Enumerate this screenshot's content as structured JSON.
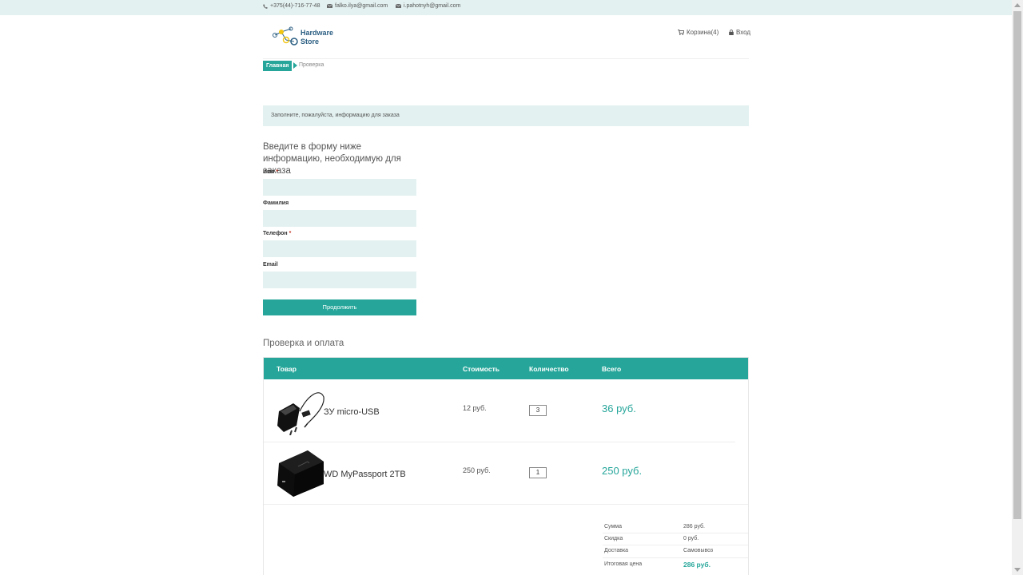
{
  "topbar": {
    "phone": "+375(44)-716-77-48",
    "email1": "falko.ilya@gmail.com",
    "email2": "i.pahotnyh@gmail.com"
  },
  "header": {
    "logo_line1": "Hardware",
    "logo_line2": "Store",
    "cart_label": "Корзина(4)",
    "login_label": "Вход"
  },
  "breadcrumb": {
    "home": "Главная",
    "current": "Проверка"
  },
  "notice": "Заполните, пожалуйста, информацию для заказа",
  "form": {
    "title": "Введите в форму ниже информацию, необходимую для заказа",
    "fields": [
      {
        "label": "Имя",
        "required": "*",
        "value": ""
      },
      {
        "label": "Фамилия",
        "required": "",
        "value": ""
      },
      {
        "label": "Телефон",
        "required": "*",
        "value": ""
      },
      {
        "label": "Email",
        "required": "",
        "value": ""
      }
    ],
    "submit": "Продолжить"
  },
  "checkout": {
    "title": "Проверка и оплата",
    "columns": [
      "Товар",
      "Стоимость",
      "Количество",
      "Всего"
    ],
    "rows": [
      {
        "name": "ЗУ micro-USB",
        "price": "12 руб.",
        "qty": "3",
        "total": "36 руб.",
        "image_icon": "charger-icon"
      },
      {
        "name": "WD MyPassport 2TB",
        "price": "250 руб.",
        "qty": "1",
        "total": "250 руб.",
        "image_icon": "hard-drive-icon"
      }
    ],
    "summary": [
      {
        "label": "Сумма",
        "value": "286 руб."
      },
      {
        "label": "Скидка",
        "value": "0 руб."
      },
      {
        "label": "Доставка",
        "value": "Самовывоз"
      },
      {
        "label": "Итоговая цена",
        "value": "286 руб."
      }
    ]
  },
  "colors": {
    "accent": "#26a69a",
    "light_bg": "#e3f1f0",
    "logo_text": "#2c5f83"
  },
  "icons": {
    "phone": "phone-icon",
    "mail": "envelope-icon",
    "cart": "shopping-cart-icon",
    "login": "lock-icon"
  }
}
